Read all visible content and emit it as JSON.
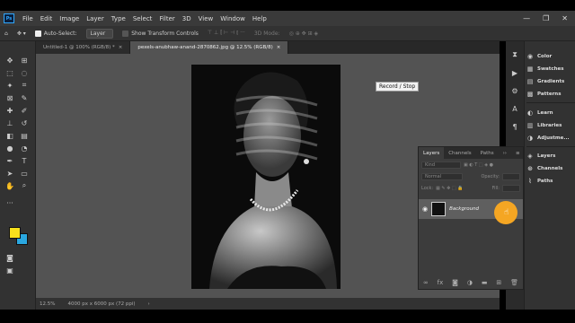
{
  "app": {
    "logo": "Ps"
  },
  "menu": [
    "File",
    "Edit",
    "Image",
    "Layer",
    "Type",
    "Select",
    "Filter",
    "3D",
    "View",
    "Window",
    "Help"
  ],
  "window_controls": [
    "—",
    "❐",
    "✕"
  ],
  "options_bar": {
    "auto_select_label": "Auto-Select:",
    "auto_select_target": "Layer",
    "show_transform_label": "Show Transform Controls",
    "mode_3d_label": "3D Mode:"
  },
  "tabs": [
    {
      "label": "Untitled-1 @ 100% (RGB/8) *",
      "active": false
    },
    {
      "label": "pexels-anubhaw-anand-2870862.jpg @ 12.5% (RGB/8)",
      "active": true
    }
  ],
  "tab_close": "×",
  "colors": {
    "foreground": "#f7e11c",
    "background": "#2aa7e0",
    "accent": "#31a8ff",
    "cursor": "#f5a623"
  },
  "tooltip": "Record / Stop",
  "status": {
    "zoom": "12.5%",
    "doc_info": "4000 px x 6000 px (72 ppi)",
    "arrow": "›"
  },
  "right_panel": {
    "group1": [
      "Color",
      "Swatches",
      "Gradients",
      "Patterns"
    ],
    "group2": [
      "Learn",
      "Libraries",
      "Adjustme..."
    ],
    "group3": [
      "Layers",
      "Channels",
      "Paths"
    ]
  },
  "layers_panel": {
    "tabs": [
      "Layers",
      "Channels",
      "Paths"
    ],
    "menu_glyph": "≡",
    "collapse_glyph": "››",
    "kind_label": "Kind",
    "blend_mode": "Normal",
    "opacity_label": "Opacity:",
    "lock_label": "Lock:",
    "fill_label": "Fill:",
    "layer_name": "Background"
  }
}
